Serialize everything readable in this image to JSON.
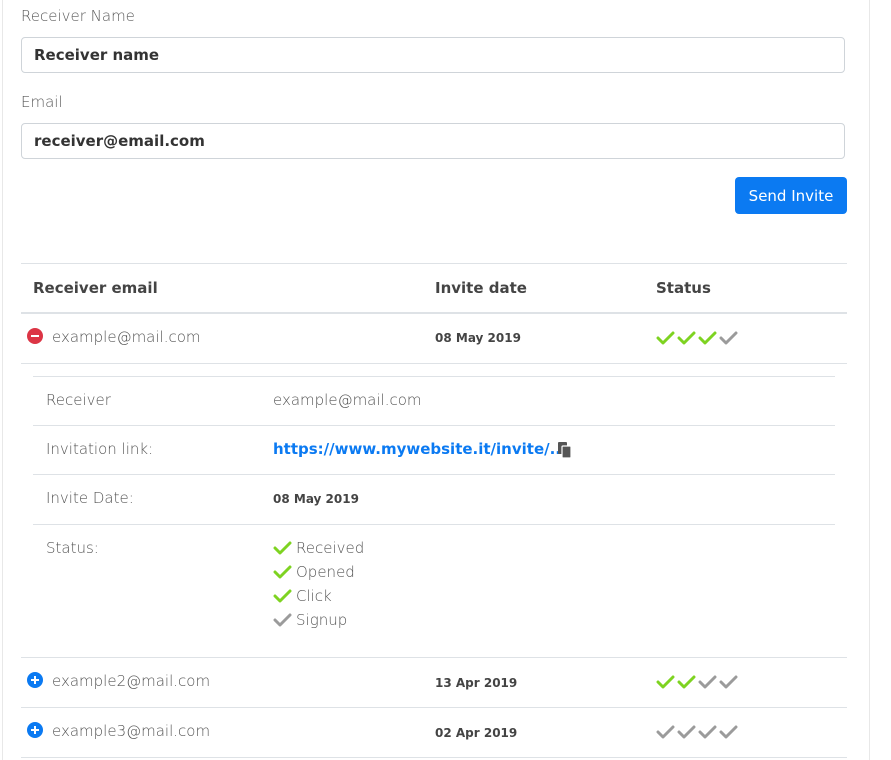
{
  "form": {
    "receiver_name_label": "Receiver Name",
    "receiver_name_value": "Receiver name",
    "email_label": "Email",
    "email_value": "receiver@email.com",
    "send_button": "Send Invite"
  },
  "table": {
    "headers": [
      "Receiver email",
      "Invite date",
      "Status"
    ],
    "rows": [
      {
        "email": "example@mail.com",
        "date": "08 May 2019",
        "expanded": true,
        "checks": [
          "green",
          "green",
          "green",
          "gray"
        ]
      },
      {
        "email": "example2@mail.com",
        "date": "13 Apr 2019",
        "expanded": false,
        "checks": [
          "green",
          "green",
          "gray",
          "gray"
        ]
      },
      {
        "email": "example3@mail.com",
        "date": "02 Apr 2019",
        "expanded": false,
        "checks": [
          "gray",
          "gray",
          "gray",
          "gray"
        ]
      }
    ]
  },
  "details": {
    "receiver_label": "Receiver",
    "receiver_value": "example@mail.com",
    "link_label": "Invitation link:",
    "link_value": "https://www.mywebsite.it/invite/...",
    "date_label": "Invite Date:",
    "date_value": "08 May 2019",
    "status_label": "Status:",
    "statuses": [
      {
        "label": "Received",
        "color": "green"
      },
      {
        "label": "Opened",
        "color": "green"
      },
      {
        "label": "Click",
        "color": "green"
      },
      {
        "label": "Signup",
        "color": "gray"
      }
    ]
  },
  "colors": {
    "accent": "#0b7af2",
    "check_green": "#7ed321",
    "check_gray": "#9b9b9b",
    "remove_red": "#dc3545"
  },
  "icons": {
    "collapse": "minus-circle-icon",
    "expand": "plus-circle-icon",
    "status": "check-icon",
    "copy": "copy-icon"
  }
}
